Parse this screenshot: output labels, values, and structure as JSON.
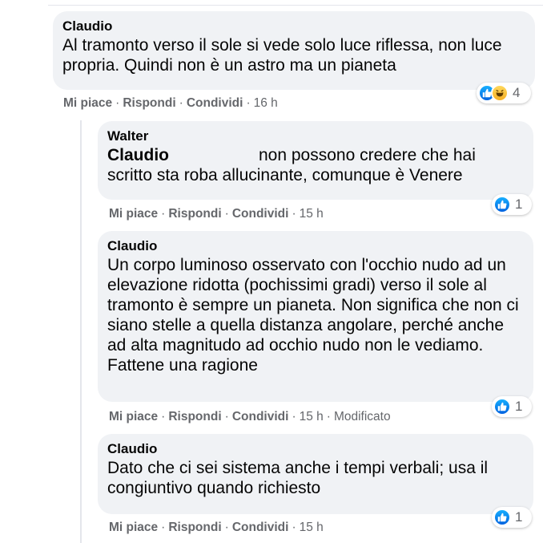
{
  "comments": [
    {
      "author": "Claudio",
      "text": "Al tramonto verso il sole si vede solo luce riflessa, non luce propria. Quindi non è un astro ma un pianeta",
      "like": "Mi piace",
      "reply": "Rispondi",
      "share": "Condividi",
      "time": "16 h",
      "edited": "",
      "reaction_count": "4",
      "reaction_icons": [
        "like-icon",
        "haha-icon"
      ]
    },
    {
      "author": "Walter",
      "mention": "Claudio",
      "text": "non possono credere che hai scritto sta roba allucinante, comunque è Venere",
      "like": "Mi piace",
      "reply": "Rispondi",
      "share": "Condividi",
      "time": "15 h",
      "edited": "",
      "reaction_count": "1",
      "reaction_icons": [
        "like-icon"
      ]
    },
    {
      "author": "Claudio",
      "text": "Un corpo luminoso osservato con l'occhio nudo ad un elevazione ridotta (pochissimi gradi) verso il sole al tramonto è sempre un pianeta. Non significa che non ci siano stelle a quella distanza angolare, perché anche ad alta magnitudo ad occhio nudo non le vediamo. Fattene una ragione",
      "like": "Mi piace",
      "reply": "Rispondi",
      "share": "Condividi",
      "time": "15 h",
      "edited": "Modificato",
      "reaction_count": "1",
      "reaction_icons": [
        "like-icon"
      ]
    },
    {
      "author": "Claudio",
      "text": "Dato che ci sei sistema anche i tempi verbali; usa il congiuntivo quando richiesto",
      "like": "Mi piace",
      "reply": "Rispondi",
      "share": "Condividi",
      "time": "15 h",
      "edited": "",
      "reaction_count": "1",
      "reaction_icons": [
        "like-icon"
      ]
    }
  ],
  "separator": "·",
  "colors": {
    "bubble": "#f0f2f5",
    "meta": "#65676b",
    "like_blue": "#1877f2",
    "haha_yellow": "#f7b125"
  }
}
